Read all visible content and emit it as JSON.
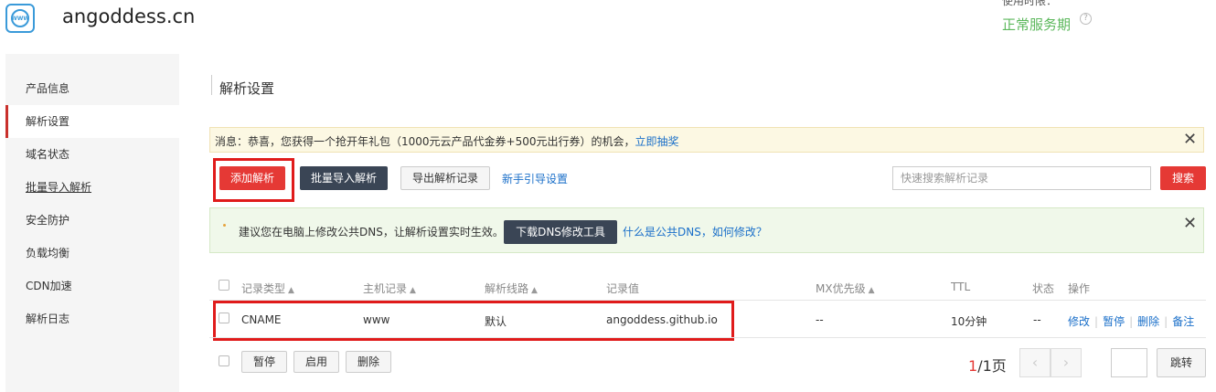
{
  "header": {
    "domain": "angoddess.cn",
    "usage_label": "使用时限：",
    "status": "正常服务期",
    "logo_text": "WWW"
  },
  "sidebar": {
    "items": [
      {
        "label": "产品信息"
      },
      {
        "label": "解析设置"
      },
      {
        "label": "域名状态"
      },
      {
        "label": "批量导入解析"
      },
      {
        "label": "安全防护"
      },
      {
        "label": "负载均衡"
      },
      {
        "label": "CDN加速"
      },
      {
        "label": "解析日志"
      }
    ],
    "active_index": 1
  },
  "main": {
    "section_title": "解析设置",
    "notice": {
      "text": "消息：恭喜，您获得一个抢开年礼包（1000元云产品代金券+500元出行券）的机会，",
      "link": "立即抽奖"
    },
    "toolbar": {
      "add": "添加解析",
      "import": "批量导入解析",
      "export": "导出解析记录",
      "guide": "新手引导设置",
      "search_placeholder": "快速搜索解析记录",
      "search": "搜索"
    },
    "dns_tip": {
      "text": "建议您在电脑上修改公共DNS，让解析设置实时生效。",
      "tool_button": "下载DNS修改工具",
      "link": "什么是公共DNS，如何修改？"
    },
    "table": {
      "columns": [
        "记录类型",
        "主机记录",
        "解析线路",
        "记录值",
        "MX优先级",
        "TTL",
        "状态",
        "操作"
      ],
      "rows": [
        {
          "type": "CNAME",
          "host": "www",
          "line": "默认",
          "value": "angoddess.github.io",
          "mx": "--",
          "ttl": "10分钟",
          "status": "--",
          "actions": [
            "修改",
            "暂停",
            "删除",
            "备注"
          ]
        }
      ],
      "batch_buttons": [
        "暂停",
        "启用",
        "删除"
      ],
      "pager": {
        "current": "1",
        "total": "/1页",
        "jump": "跳转"
      }
    }
  },
  "colors": {
    "accent_red": "#e53935",
    "dark_button": "#3a4555",
    "link": "#1a6fc9",
    "status_green": "#5cb85c"
  }
}
